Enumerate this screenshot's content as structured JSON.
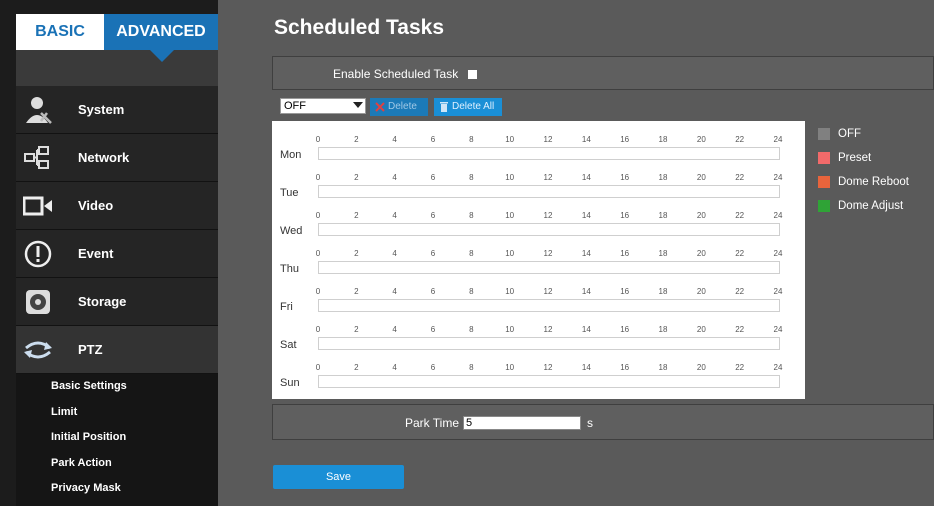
{
  "sidebar": {
    "tabs": {
      "basic": "BASIC",
      "advanced": "ADVANCED"
    },
    "menu": [
      {
        "label": "System",
        "icon": "system-icon"
      },
      {
        "label": "Network",
        "icon": "network-icon"
      },
      {
        "label": "Video",
        "icon": "video-icon"
      },
      {
        "label": "Event",
        "icon": "event-icon"
      },
      {
        "label": "Storage",
        "icon": "storage-icon"
      },
      {
        "label": "PTZ",
        "icon": "ptz-icon"
      }
    ],
    "submenu": [
      "Basic Settings",
      "Limit",
      "Initial Position",
      "Park Action",
      "Privacy Mask"
    ]
  },
  "main": {
    "title": "Scheduled Tasks",
    "enable_label": "Enable Scheduled Task",
    "select_value": "OFF",
    "delete_label": "Delete",
    "delete_all_label": "Delete All",
    "days": [
      "Mon",
      "Tue",
      "Wed",
      "Thu",
      "Fri",
      "Sat",
      "Sun"
    ],
    "hour_ticks": [
      "0",
      "2",
      "4",
      "6",
      "8",
      "10",
      "12",
      "14",
      "16",
      "18",
      "20",
      "22",
      "24"
    ],
    "legend": [
      {
        "label": "OFF",
        "color": "#808080"
      },
      {
        "label": "Preset",
        "color": "#f26a6a"
      },
      {
        "label": "Dome Reboot",
        "color": "#e8643c"
      },
      {
        "label": "Dome Adjust",
        "color": "#2fa336"
      }
    ],
    "park_time_label": "Park Time",
    "park_time_value": "5",
    "park_time_unit": "s",
    "save_label": "Save"
  },
  "colors": {
    "accent": "#1a72b6",
    "button": "#1a8fd6"
  }
}
